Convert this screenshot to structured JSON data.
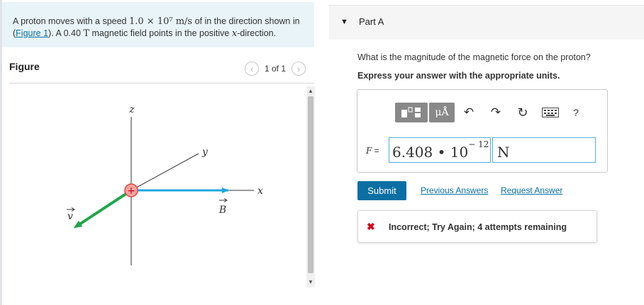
{
  "problem": {
    "text_1": "A proton moves with a speed ",
    "speed": "1.0 × 10⁷ m/s",
    "text_2": " of in the direction shown in (",
    "figure_link": "Figure 1",
    "text_3": "). A 0.40 ",
    "field_unit": "T",
    "text_4": " magnetic field points in the positive ",
    "x_var": "x",
    "text_5": "-direction."
  },
  "figure": {
    "title": "Figure",
    "pager_label": "1 of 1",
    "prev_icon": "chevron-left-icon",
    "next_icon": "chevron-right-icon",
    "axis_z": "z",
    "axis_y": "y",
    "axis_x": "x",
    "b_label": "B",
    "v_label": "v",
    "proton_symbol": "+",
    "colors": {
      "b_arrow": "#1aa7dc",
      "v_arrow": "#1fa64a",
      "proton": "#e8453c",
      "axes": "#333333"
    }
  },
  "part": {
    "caret": "▼",
    "title": "Part A"
  },
  "question": "What is the magnitude of the magnetic force on the proton?",
  "instruction": "Express your answer with the appropriate units.",
  "toolbar": {
    "unit_label": "μÅ",
    "undo": "↶",
    "redo": "↷",
    "reset": "↻",
    "help": "?"
  },
  "answer": {
    "label_var": "F",
    "label_eq": " =",
    "mantissa": "6.408 • 10",
    "exponent": "− 12",
    "unit": "N"
  },
  "buttons": {
    "submit": "Submit",
    "previous_answers": "Previous Answers",
    "request_answer": "Request Answer"
  },
  "feedback": {
    "icon": "✖",
    "text": "Incorrect; Try Again; 4 attempts remaining",
    "color": "#d0021b"
  },
  "accent_color": "#0b6fa4"
}
